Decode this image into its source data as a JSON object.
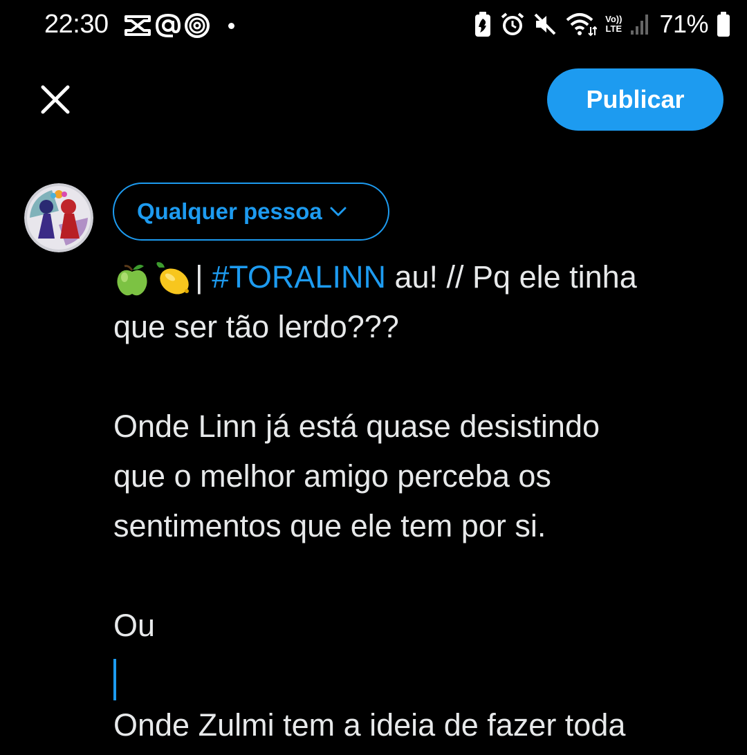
{
  "status_bar": {
    "time": "22:30",
    "battery_percent": "71%",
    "network_label": "Vo)) LTE",
    "icons": [
      "capcut-icon",
      "at-sign-icon",
      "threads-icon",
      "notification-dot",
      "battery-saver-icon",
      "alarm-icon",
      "mute-icon",
      "wifi-icon",
      "volte-lte-icon",
      "signal-icon",
      "battery-icon"
    ]
  },
  "toolbar": {
    "close_icon": "close-icon",
    "publish_label": "Publicar"
  },
  "composer": {
    "audience_label": "Qualquer pessoa",
    "audience_icon": "chevron-down-icon",
    "avatar_icon": "profile-avatar",
    "line1_separator": "|",
    "hashtag": "#TORALINN",
    "line1_rest": " au! // Pq ele tinha",
    "line2": "que ser tão lerdo???",
    "line4": "Onde Linn já está quase desistindo",
    "line5": "que o melhor amigo perceba os",
    "line6": "sentimentos que ele tem por si.",
    "line8": "Ou",
    "line10": "Onde Zulmi tem a ideia de fazer toda"
  },
  "colors": {
    "accent": "#1d9bf0",
    "background": "#000000",
    "text": "#e7e9ea"
  }
}
